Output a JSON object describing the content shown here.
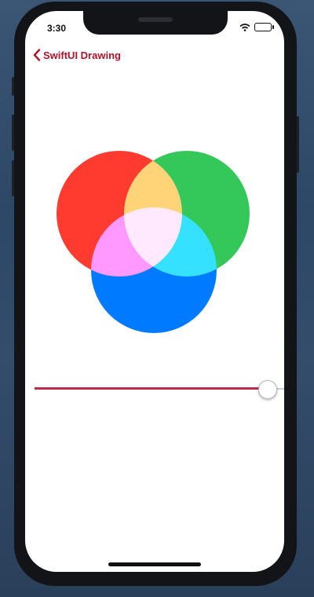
{
  "status_bar": {
    "time": "3:30"
  },
  "nav": {
    "back_label": "SwiftUI Drawing"
  },
  "venn": {
    "colors": {
      "red": "#ff3b30",
      "green": "#34c759",
      "blue": "#007aff"
    },
    "blend": "screen"
  },
  "slider": {
    "value": 0.93,
    "accent_color": "#c1284a"
  }
}
